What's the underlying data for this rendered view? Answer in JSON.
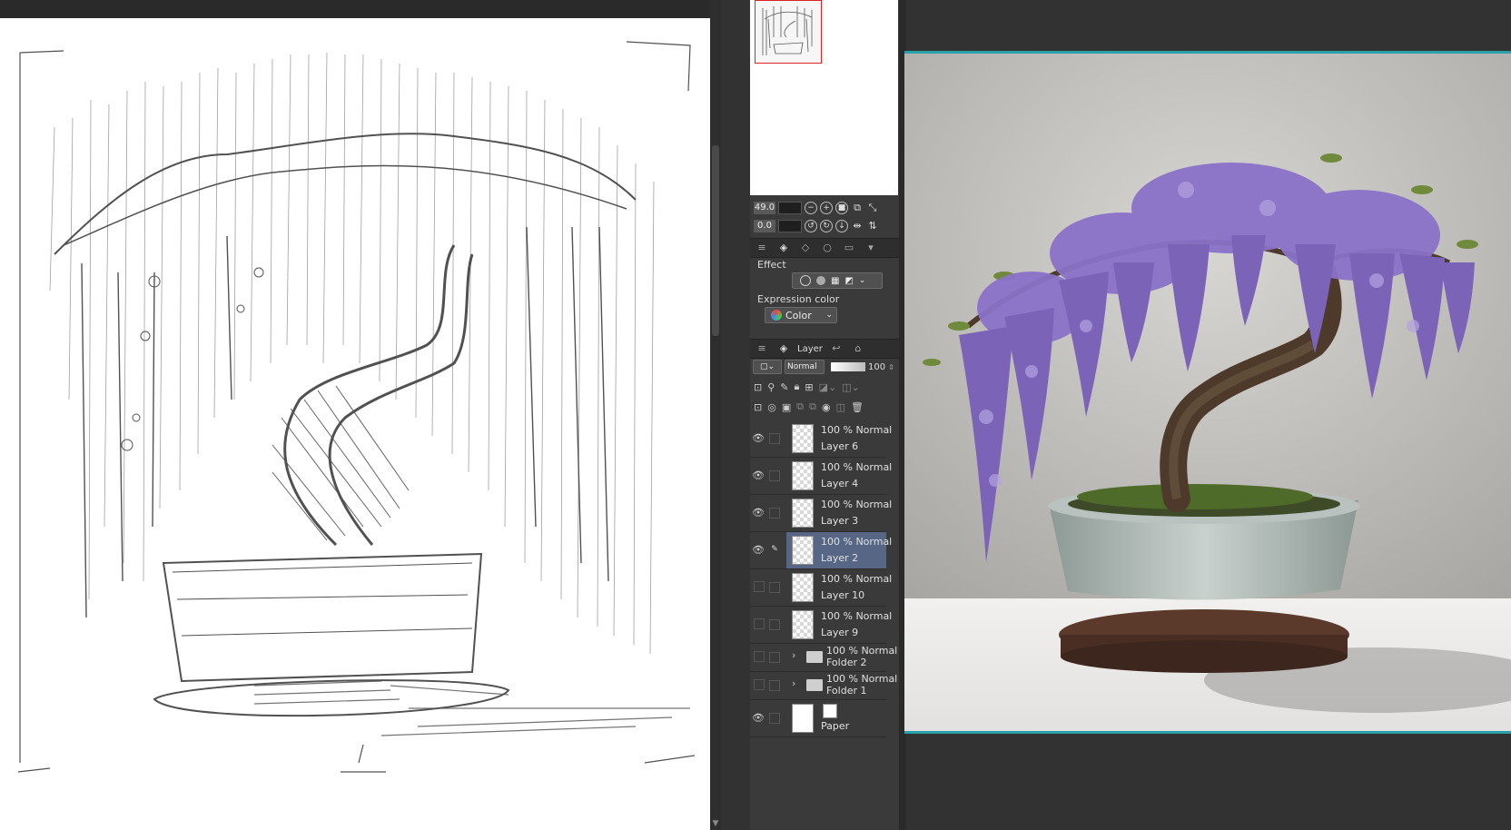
{
  "navigator": {
    "zoom_value": "49.0",
    "rotate_value": "0.0"
  },
  "tool_property": {
    "effect_label": "Effect",
    "expression_color_label": "Expression color",
    "expression_color_value": "Color"
  },
  "layer_panel": {
    "tab_label": "Layer",
    "blend_mode_value": "Normal",
    "opacity_value": "100",
    "layers": [
      {
        "mode": "100 % Normal",
        "name": "Layer 6",
        "visible": true,
        "type": "raster"
      },
      {
        "mode": "100 % Normal",
        "name": "Layer 4",
        "visible": true,
        "type": "raster"
      },
      {
        "mode": "100 % Normal",
        "name": "Layer 3",
        "visible": true,
        "type": "raster"
      },
      {
        "mode": "100 % Normal",
        "name": "Layer 2",
        "visible": true,
        "type": "raster",
        "selected": true
      },
      {
        "mode": "100 % Normal",
        "name": "Layer 10",
        "visible": false,
        "type": "raster"
      },
      {
        "mode": "100 % Normal",
        "name": "Layer 9",
        "visible": false,
        "type": "raster"
      },
      {
        "mode": "100 % Normal",
        "name": "Folder 2",
        "visible": false,
        "type": "folder"
      },
      {
        "mode": "100 % Normal",
        "name": "Folder 1",
        "visible": false,
        "type": "folder"
      },
      {
        "mode": "",
        "name": "Paper",
        "visible": true,
        "type": "paper"
      }
    ]
  },
  "colors": {
    "accent_teal": "#2aa0a8",
    "selection_blue": "#566684",
    "wisteria_purple": "#8a72c8"
  }
}
